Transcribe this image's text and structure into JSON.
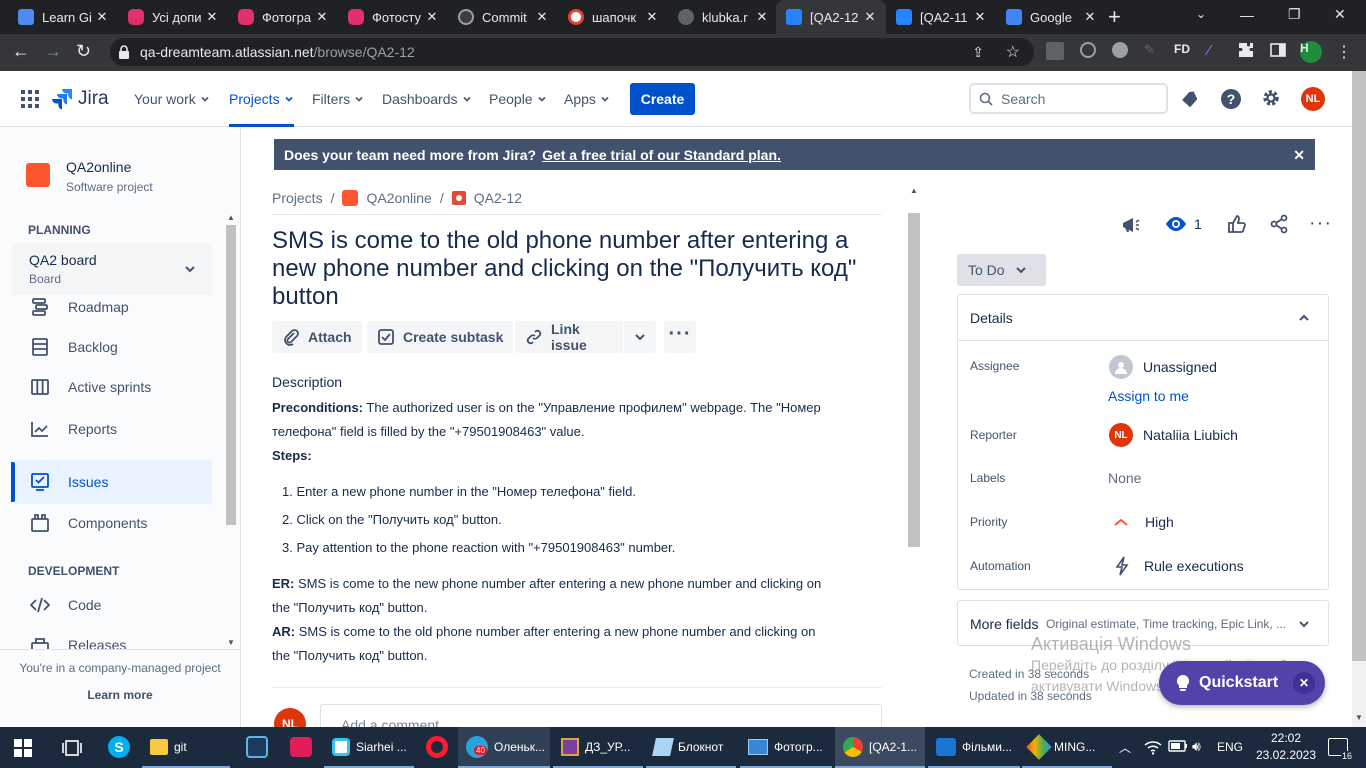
{
  "browser": {
    "tabs": [
      {
        "title": "Learn Gi",
        "color": "#4c8bf5"
      },
      {
        "title": "Усі допи",
        "color": "#e1306c"
      },
      {
        "title": "Фотогра",
        "color": "#e1306c"
      },
      {
        "title": "Фотосту",
        "color": "#e1306c"
      },
      {
        "title": "Commit",
        "color": "#e8eaed"
      },
      {
        "title": "шапочк",
        "color": "#ea4335"
      },
      {
        "title": "klubka.r",
        "color": "#9aa0a6"
      },
      {
        "title": "[QA2-12",
        "color": "#2684ff"
      },
      {
        "title": "[QA2-11",
        "color": "#2684ff"
      },
      {
        "title": "Google",
        "color": "#4285f4"
      }
    ],
    "url_host": "qa-dreamteam.atlassian.net",
    "url_path": "/browse/QA2-12",
    "profile_initial": "H",
    "ext_fd": "FD"
  },
  "header": {
    "logo": "Jira",
    "nav": [
      {
        "label": "Your work",
        "selected": false
      },
      {
        "label": "Projects",
        "selected": true
      },
      {
        "label": "Filters",
        "selected": false
      },
      {
        "label": "Dashboards",
        "selected": false
      },
      {
        "label": "People",
        "selected": false
      },
      {
        "label": "Apps",
        "selected": false
      }
    ],
    "create_label": "Create",
    "search_placeholder": "Search",
    "avatar": "NL"
  },
  "sidebar": {
    "project_name": "QA2online",
    "project_type": "Software project",
    "planning_heading": "PLANNING",
    "board_name": "QA2 board",
    "board_type": "Board",
    "items": [
      {
        "label": "Roadmap"
      },
      {
        "label": "Backlog"
      },
      {
        "label": "Active sprints"
      },
      {
        "label": "Reports"
      },
      {
        "label": "Issues"
      },
      {
        "label": "Components"
      }
    ],
    "development_heading": "DEVELOPMENT",
    "dev_items": [
      {
        "label": "Code"
      },
      {
        "label": "Releases"
      }
    ],
    "footer_text": "You're in a company-managed project",
    "learn_more": "Learn more"
  },
  "banner": {
    "text": "Does your team need more from Jira?",
    "link": "Get a free trial of our Standard plan."
  },
  "breadcrumb": {
    "projects": "Projects",
    "project": "QA2online",
    "issue": "QA2-12"
  },
  "issue": {
    "title": "SMS is come to the old phone number after entering a new phone number and clicking on the \"Получить код\" button",
    "actions": {
      "attach": "Attach",
      "subtask": "Create subtask",
      "link": "Link issue"
    },
    "description_label": "Description",
    "preconditions_label": "Preconditions:",
    "preconditions_text1": " The authorized user is on the \"Управление профилем\" webpage. The \"Номер",
    "preconditions_text2": "телефона\" field is filled by the \"+79501908463\" value.",
    "steps_label": "Steps:",
    "steps": [
      "1. Enter a new phone number in the \"Номер телефона\" field.",
      "2. Click on the \"Получить код\" button.",
      "3. Pay attention to the phone reaction with \"+79501908463\" number."
    ],
    "er_label": "ER:",
    "er_text1": " SMS is come to the new phone number after entering a new phone number and clicking on",
    "er_text2": "the \"Получить код\" button.",
    "ar_label": "AR:",
    "ar_text1": " SMS is come to the old phone number after entering a new phone number and clicking on",
    "ar_text2": "the \"Получить код\" button.",
    "comment_avatar": "NL",
    "comment_placeholder": "Add a comment..."
  },
  "details": {
    "watch_count": "1",
    "status": "To Do",
    "heading": "Details",
    "assignee_label": "Assignee",
    "assignee_value": "Unassigned",
    "assign_to_me": "Assign to me",
    "reporter_label": "Reporter",
    "reporter_avatar": "NL",
    "reporter_value": "Nataliia Liubich",
    "labels_label": "Labels",
    "labels_value": "None",
    "priority_label": "Priority",
    "priority_value": "High",
    "automation_label": "Automation",
    "automation_value": "Rule executions",
    "more_fields": "More fields",
    "more_fields_hint": "Original estimate, Time tracking, Epic Link, ...",
    "created": "Created in 38 seconds",
    "updated": "Updated in 38 seconds",
    "quickstart": "Quickstart"
  },
  "watermark": {
    "line1": "Активація Windows",
    "line2": "Перейдіть до розділу \"Настройки\", щоб",
    "line3": "активувати Windows."
  },
  "taskbar": {
    "apps": [
      {
        "label": "git"
      },
      {
        "label": "Siarhei ..."
      },
      {
        "label": "Оленьк..."
      },
      {
        "label": "ДЗ_УР..."
      },
      {
        "label": "Блокнот"
      },
      {
        "label": "Фотогр..."
      },
      {
        "label": "[QA2-1..."
      },
      {
        "label": "Фільми..."
      },
      {
        "label": "MING..."
      }
    ],
    "telegram_badge": "40",
    "lang": "ENG",
    "time": "22:02",
    "date": "23.02.2023",
    "notif_count": "16"
  }
}
